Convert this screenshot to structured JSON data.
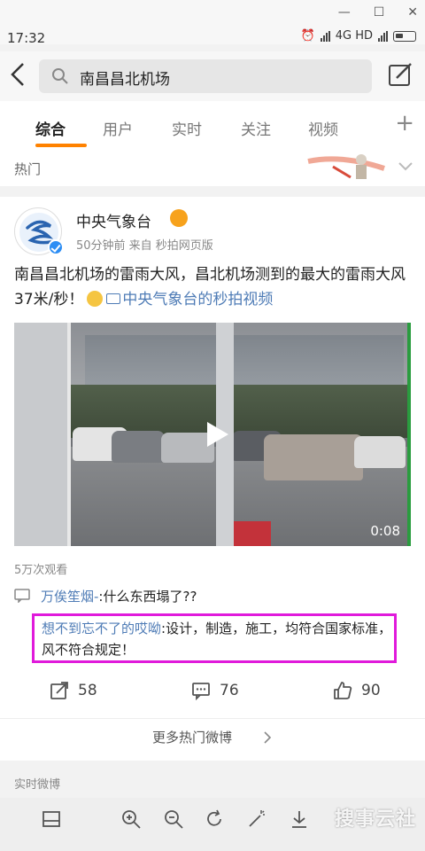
{
  "status": {
    "time": "17:32",
    "network": "4G HD"
  },
  "search": {
    "query": "南昌昌北机场"
  },
  "tabs": [
    "综合",
    "用户",
    "实时",
    "关注",
    "视频"
  ],
  "hot": {
    "label": "热门"
  },
  "post": {
    "author": "中央气象台",
    "meta": "50分钟前  来自 秒拍网页版",
    "text": "南昌昌北机场的雷雨大风，昌北机场测到的最大的雷雨大风37米/秒！",
    "link": "中央气象台的秒拍视频",
    "video_duration": "0:08",
    "views": "5万次观看"
  },
  "comment": {
    "user": "万俟笙烟-",
    "text": ":什么东西塌了??"
  },
  "reply": {
    "user": "想不到忘不了的哎呦",
    "text": ":设计，制造，施工，均符合国家标准，风不符合规定！"
  },
  "actions": {
    "repost_count": "58",
    "comment_count": "76",
    "like_count": "90"
  },
  "more": {
    "label": "更多热门微博"
  },
  "realtime": {
    "label": "实时微博"
  },
  "watermark": {
    "text": "搜事云社"
  },
  "colors": {
    "accent": "#ff8200",
    "link": "#4f7cb6",
    "highlight": "#e01adb"
  }
}
